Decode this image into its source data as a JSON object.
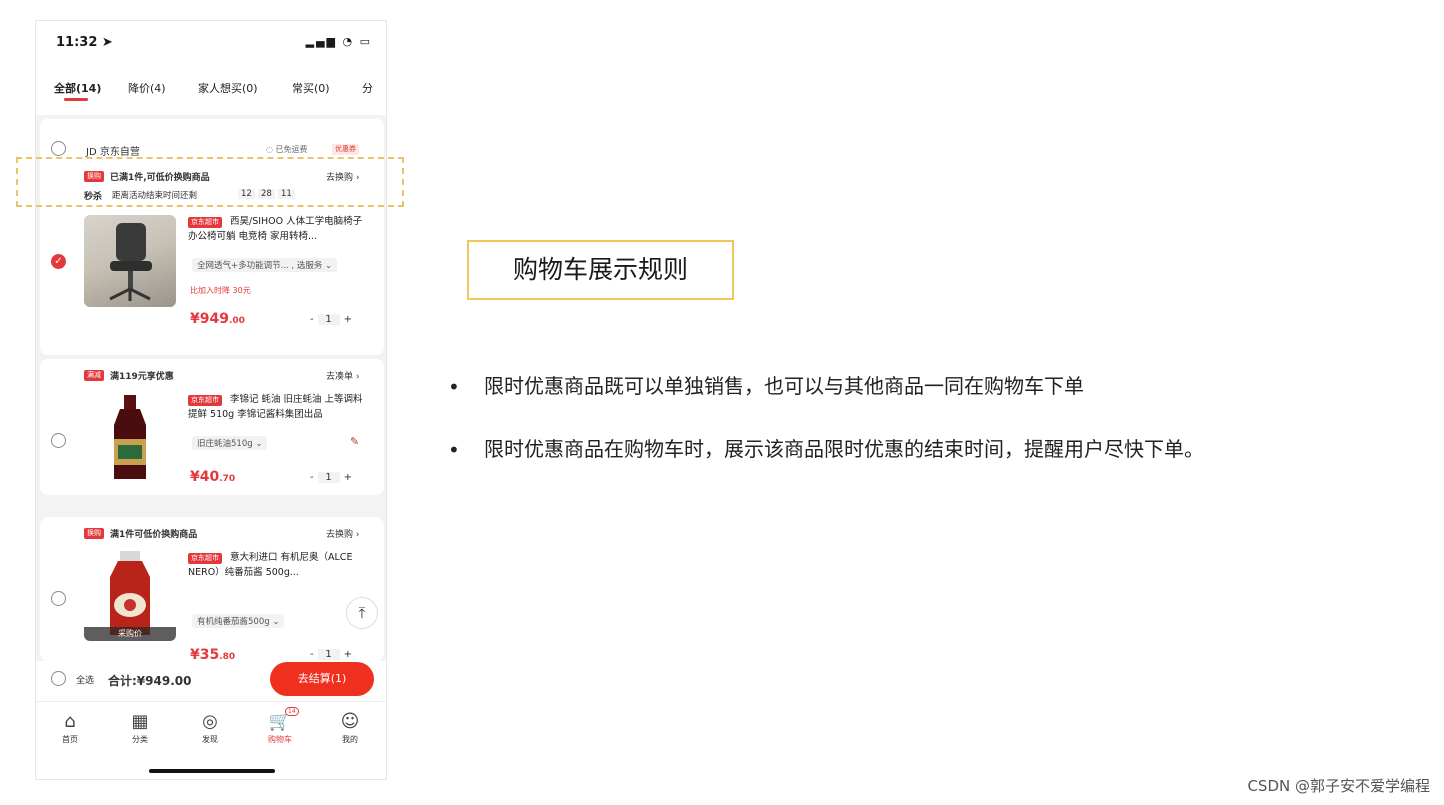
{
  "status_bar": {
    "time": "11:32 ➤",
    "icons": "▂▄▆ ◔ ▭"
  },
  "tabs": [
    {
      "label": "全部(14)"
    },
    {
      "label": "降价(4)"
    },
    {
      "label": "家人想买(0)"
    },
    {
      "label": "常买(0)"
    },
    {
      "label": "分"
    }
  ],
  "store": {
    "name": "JD 京东自营",
    "shipping": "◌ 已免运费",
    "coupon": "优惠券"
  },
  "promo_top": {
    "tag": "换购",
    "text": "已满1件,可低价换购商品",
    "link": "去换购 ›",
    "flash_label": "秒杀",
    "countdown_label": "距离活动结束时间还剩",
    "countdown": [
      "12",
      "28",
      "11"
    ]
  },
  "products": [
    {
      "tag": "京东超市",
      "title": "西昊/SIHOO 人体工学电脑椅子 办公椅可躺 电竞椅 家用转椅...",
      "spec": "全网透气+多功能调节... , 选服务 ⌄",
      "note": "比加入时降 30元",
      "price_int": "¥949",
      "price_dec": ".00",
      "qty": "1"
    },
    {
      "tag": "京东超市",
      "title": "李锦记 蚝油 旧庄蚝油 上等调料提鲜 510g 李锦记酱料集团出品",
      "spec": "旧庄蚝油510g ⌄",
      "price_int": "¥40",
      "price_dec": ".70",
      "qty": "1"
    },
    {
      "tag": "京东超市",
      "title": "意大利进口 有机尼奥（ALCE NERO）纯番茄酱 500g...",
      "spec": "有机纯番茄酱500g ⌄",
      "price_int": "¥35",
      "price_dec": ".80",
      "qty": "1",
      "overlay": "采购价"
    }
  ],
  "promo2": {
    "tag": "满减",
    "text": "满119元享优惠",
    "link": "去凑单 ›"
  },
  "promo3": {
    "tag": "换购",
    "text": "满1件可低价换购商品",
    "link": "去换购 ›"
  },
  "checkout": {
    "select_all": "全选",
    "total": "合计:¥949.00",
    "button": "去结算(1)"
  },
  "bottom_nav": [
    {
      "label": "首页",
      "icon": "⌂"
    },
    {
      "label": "分类",
      "icon": "▦"
    },
    {
      "label": "发现",
      "icon": "◎"
    },
    {
      "label": "购物车",
      "icon": "🛒",
      "badge": "14"
    },
    {
      "label": "我的",
      "icon": "☺"
    }
  ],
  "stepper": {
    "minus": "-",
    "plus": "+"
  },
  "right": {
    "title": "购物车展示规则",
    "bullets": [
      "限时优惠商品既可以单独销售，也可以与其他商品一同在购物车下单",
      "限时优惠商品在购物车时，展示该商品限时优惠的结束时间，提醒用户尽快下单。"
    ]
  },
  "watermark": "CSDN @郭子安不爱学编程",
  "colors": {
    "accent": "#e4393c",
    "highlight": "#f0c65a"
  }
}
